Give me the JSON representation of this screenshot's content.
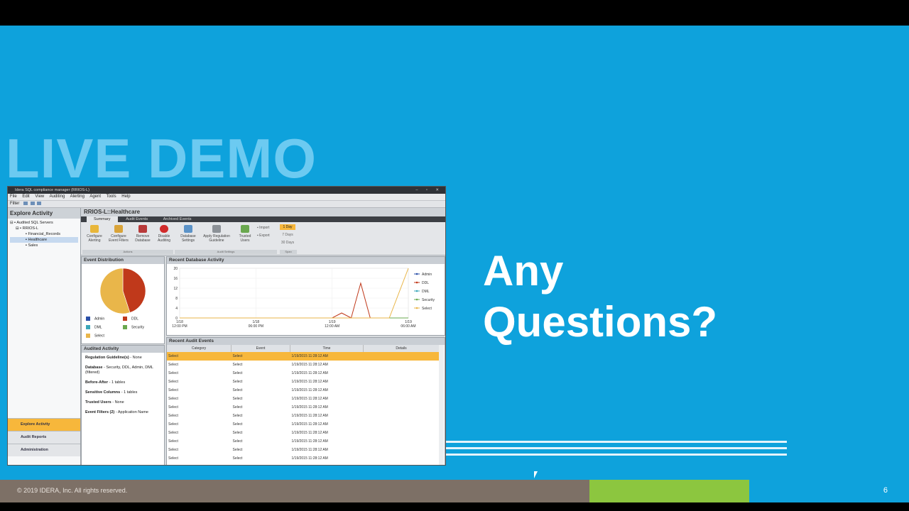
{
  "slide": {
    "heading": "LIVE DEMO",
    "questions_line1": "Any",
    "questions_line2": "Questions?",
    "copyright": "© 2019 IDERA, Inc. All rights reserved.",
    "page_number": "6"
  },
  "app": {
    "title": "Idera SQL compliance manager (RRIOS-L)",
    "menu": [
      "File",
      "Edit",
      "View",
      "Auditing",
      "Alerting",
      "Agent",
      "Tools",
      "Help"
    ],
    "filter_label": "Filter",
    "explore_title": "Explore Activity",
    "tree": [
      "Audited SQL Servers",
      "RRIOS-L",
      "Financial_Records",
      "Healthcare",
      "Sales"
    ],
    "nav_buttons": [
      "Explore Activity",
      "Audit Reports",
      "Administration"
    ],
    "main_title": "RRIOS-L::Healthcare",
    "tabs": [
      "Summary",
      "Audit Events",
      "Archived Events"
    ],
    "ribbon": [
      {
        "line1": "Configure",
        "line2": "Alerting",
        "icon": "alert-icon"
      },
      {
        "line1": "Configure",
        "line2": "Event Filters",
        "icon": "filter-icon"
      },
      {
        "line1": "Remove",
        "line2": "Database",
        "icon": "remove-icon"
      },
      {
        "line1": "Disable",
        "line2": "Auditing",
        "icon": "disable-icon"
      },
      {
        "line1": "Database",
        "line2": "Settings",
        "icon": "settings-icon"
      },
      {
        "line1": "Apply Regulation",
        "line2": "Guideline",
        "icon": "regulation-icon"
      },
      {
        "line1": "Trusted",
        "line2": "Users",
        "icon": "users-icon"
      }
    ],
    "ribbon_groups": [
      "Actions",
      "Audit Settings",
      "Span"
    ],
    "import_label": "Import",
    "export_label": "Export",
    "span_options": [
      "1 Day",
      "7 Days",
      "30 Days"
    ],
    "event_dist_title": "Event Distribution",
    "event_legend": [
      {
        "name": "Admin",
        "color": "#2a4fa8"
      },
      {
        "name": "DDL",
        "color": "#c0391b"
      },
      {
        "name": "DML",
        "color": "#3aa6b9"
      },
      {
        "name": "Security",
        "color": "#6aa84f"
      },
      {
        "name": "Select",
        "color": "#e9b64a"
      }
    ],
    "audited_activity_title": "Audited Activity",
    "audited_activity": [
      {
        "label": "Regulation Guideline(s)",
        "value": " - None"
      },
      {
        "label": "Database",
        "value": " - Security, DDL, Admin, DML (filtered)"
      },
      {
        "label": "Before-After",
        "value": " - 1 tables"
      },
      {
        "label": "Sensitive Columns",
        "value": " - 1 tables"
      },
      {
        "label": "Trusted Users",
        "value": " - None"
      },
      {
        "label": "Event Filters (2)",
        "value": " - Application Name"
      }
    ],
    "recent_db_title": "Recent Database Activity",
    "recent_events_title": "Recent Audit Events",
    "event_columns": [
      "Category",
      "Event",
      "Time",
      "Details"
    ],
    "events": [
      {
        "category": "Select",
        "event": "Select",
        "time": "1/19/2015 11:28:12 AM"
      },
      {
        "category": "Select",
        "event": "Select",
        "time": "1/19/2015 11:28:12 AM"
      },
      {
        "category": "Select",
        "event": "Select",
        "time": "1/19/2015 11:28:12 AM"
      },
      {
        "category": "Select",
        "event": "Select",
        "time": "1/19/2015 11:28:12 AM"
      },
      {
        "category": "Select",
        "event": "Select",
        "time": "1/19/2015 11:28:12 AM"
      },
      {
        "category": "Select",
        "event": "Select",
        "time": "1/19/2015 11:28:12 AM"
      },
      {
        "category": "Select",
        "event": "Select",
        "time": "1/19/2015 11:28:12 AM"
      },
      {
        "category": "Select",
        "event": "Select",
        "time": "1/19/2015 11:28:12 AM"
      },
      {
        "category": "Select",
        "event": "Select",
        "time": "1/19/2015 11:28:12 AM"
      },
      {
        "category": "Select",
        "event": "Select",
        "time": "1/19/2015 11:28:12 AM"
      },
      {
        "category": "Select",
        "event": "Select",
        "time": "1/19/2015 11:28:12 AM"
      },
      {
        "category": "Select",
        "event": "Select",
        "time": "1/19/2015 11:28:12 AM"
      },
      {
        "category": "Select",
        "event": "Select",
        "time": "1/19/2015 11:28:12 AM"
      },
      {
        "category": "Select",
        "event": "Select",
        "time": "1/19/2015 11:28:12 AM"
      },
      {
        "category": "Select",
        "event": "Select",
        "time": "1/19/2015 11:28:12 AM"
      }
    ]
  },
  "chart_data": [
    {
      "type": "pie",
      "title": "Event Distribution",
      "labels": [
        "DDL",
        "Select"
      ],
      "values": [
        45,
        55
      ],
      "colors": [
        "#c0391b",
        "#e9b64a"
      ]
    },
    {
      "type": "line",
      "title": "Recent Database Activity",
      "ylim": [
        0,
        20
      ],
      "y_ticks": [
        0,
        4,
        8,
        12,
        16,
        20
      ],
      "x_ticks": [
        "1/18 12:00 PM",
        "1/18 06:00 PM",
        "1/19 12:00 AM",
        "1/19 06:00 AM"
      ],
      "x": [
        0,
        2,
        4,
        6,
        8,
        10,
        12,
        14,
        16,
        17,
        18,
        19,
        20,
        21,
        22,
        24
      ],
      "series": [
        {
          "name": "Admin",
          "color": "#2a4fa8",
          "values": [
            0,
            0,
            0,
            0,
            0,
            0,
            0,
            0,
            0,
            0,
            0,
            0,
            0,
            0,
            0,
            0
          ]
        },
        {
          "name": "DDL",
          "color": "#c0391b",
          "values": [
            0,
            0,
            0,
            0,
            0,
            0,
            0,
            0,
            0,
            2,
            0,
            14,
            0,
            0,
            0,
            0
          ]
        },
        {
          "name": "DML",
          "color": "#3aa6b9",
          "values": [
            0,
            0,
            0,
            0,
            0,
            0,
            0,
            0,
            0,
            0,
            0,
            0,
            0,
            0,
            0,
            0
          ]
        },
        {
          "name": "Security",
          "color": "#6aa84f",
          "values": [
            0,
            0,
            0,
            0,
            0,
            0,
            0,
            0,
            0,
            0,
            0,
            0,
            0,
            0,
            0,
            0
          ]
        },
        {
          "name": "Select",
          "color": "#e9b64a",
          "values": [
            0,
            0,
            0,
            0,
            0,
            0,
            0,
            0,
            0,
            0,
            0,
            0,
            0,
            0,
            0,
            20
          ]
        }
      ]
    }
  ]
}
